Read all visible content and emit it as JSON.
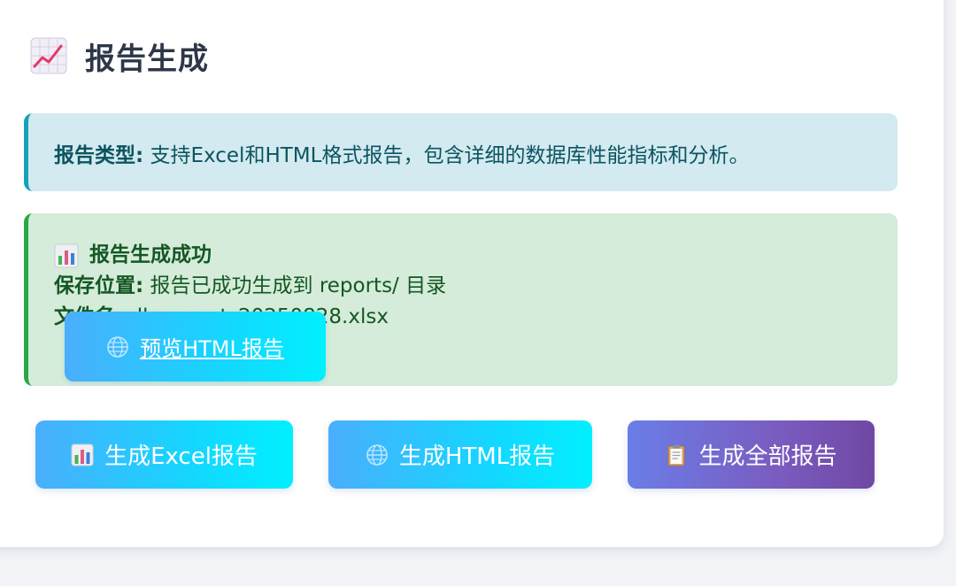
{
  "section": {
    "title": "报告生成",
    "title_icon": "chart-increasing-icon"
  },
  "info_alert": {
    "label": "报告类型:",
    "text": " 支持Excel和HTML格式报告，包含详细的数据库性能指标和分析。",
    "accent_color": "#17a2b8"
  },
  "success_alert": {
    "heading": "报告生成成功",
    "heading_icon": "bar-chart-icon",
    "location_label": "保存位置:",
    "location_text": " 报告已成功生成到 reports/ 目录",
    "filename_label": "文件名:",
    "filename_text": " db_report_20250828.xlsx",
    "accent_color": "#28a745"
  },
  "preview_button": {
    "label": "预览HTML报告",
    "icon": "globe-icon"
  },
  "actions": {
    "excel_label": "生成Excel报告",
    "excel_icon": "bar-chart-icon",
    "html_label": "生成HTML报告",
    "html_icon": "globe-icon",
    "all_label": "生成全部报告",
    "all_icon": "clipboard-icon"
  },
  "colors": {
    "primary_gradient": [
      "#4aaefc",
      "#00f0ff"
    ],
    "purple_gradient": [
      "#6a7ee8",
      "#7048a4"
    ]
  }
}
